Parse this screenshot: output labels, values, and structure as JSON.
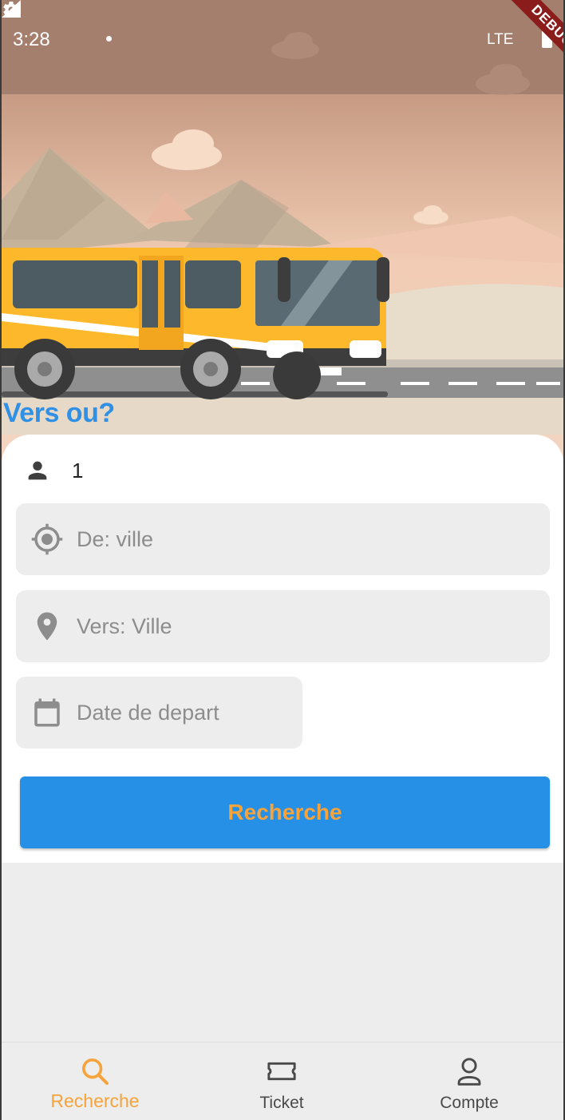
{
  "status_bar": {
    "time": "3:28",
    "network": "LTE",
    "icons": [
      "gear-icon",
      "notification-dot-icon",
      "signal-icon",
      "battery-icon"
    ]
  },
  "debug_banner": "DEBUG",
  "hero": {
    "image": "bus-illustration",
    "title": "Vers ou?"
  },
  "form": {
    "passenger_icon": "person-icon",
    "passenger_count": "1",
    "from": {
      "icon": "crosshair-location-icon",
      "placeholder": "De: ville"
    },
    "to": {
      "icon": "map-pin-icon",
      "placeholder": "Vers: Ville"
    },
    "date": {
      "icon": "calendar-icon",
      "placeholder": "Date de depart"
    },
    "submit_label": "Recherche"
  },
  "bottom_nav": {
    "items": [
      {
        "label": "Recherche",
        "icon": "search-icon",
        "active": true
      },
      {
        "label": "Ticket",
        "icon": "ticket-icon",
        "active": false
      },
      {
        "label": "Compte",
        "icon": "person-outline-icon",
        "active": false
      }
    ]
  },
  "colors": {
    "primary": "#2690e6",
    "accent": "#f6a33c",
    "title": "#2f90e6",
    "field_bg": "#ededed",
    "placeholder": "#8d8d8d"
  }
}
